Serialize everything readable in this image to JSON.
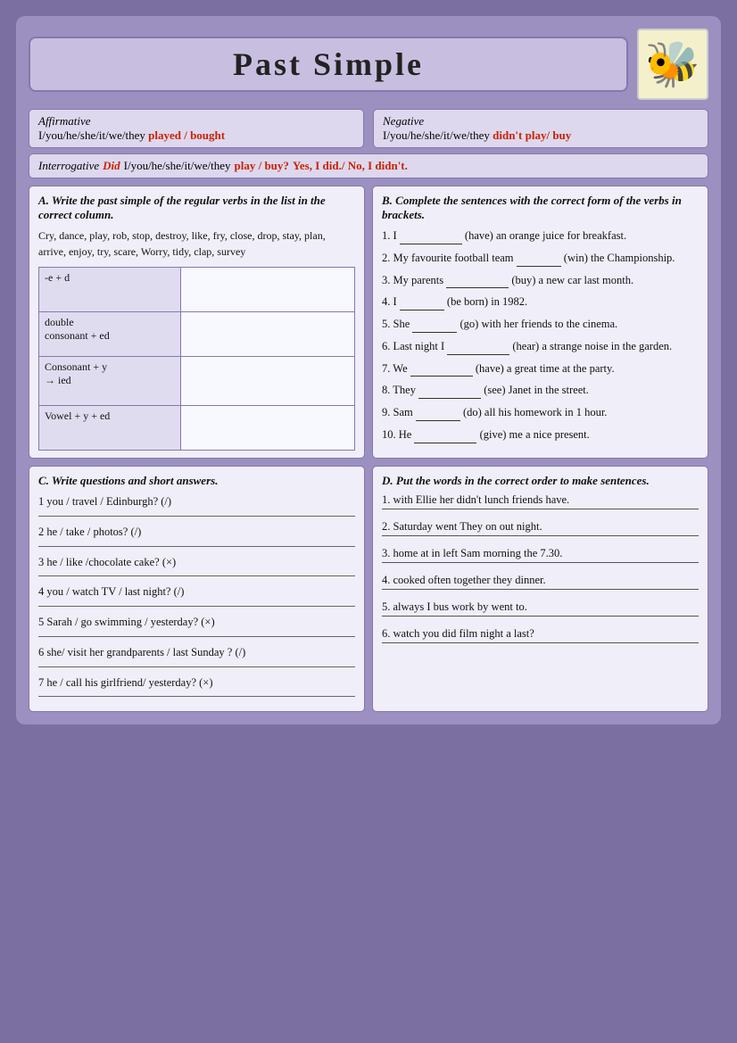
{
  "page": {
    "title": "Past Simple",
    "bee_icon": "🐝",
    "grammar": {
      "affirmative_label": "Affirmative",
      "affirmative_subject": "I/you/he/she/it/we/they",
      "affirmative_verbs": "played / bought",
      "negative_label": "Negative",
      "negative_subject": "I/you/he/she/it/we/they",
      "negative_verbs": "didn't play/ buy",
      "interrogative_label": "Interrogative",
      "interrogative_did": "Did",
      "interrogative_subject": "I/you/he/she/it/we/they",
      "interrogative_verbs": "play / buy?",
      "interrogative_answer": "Yes, I did./ No, I didn't."
    },
    "section_a": {
      "title": "A. Write the past simple of the regular verbs in the list in the correct column.",
      "verb_list": "Cry, dance, play, rob, stop, destroy, like, fry, close, drop, stay, plan, arrive, enjoy, try, scare, Worry, tidy, clap, survey",
      "rows": [
        {
          "label": "-e + d",
          "content": ""
        },
        {
          "label": "double consonant + ed",
          "content": ""
        },
        {
          "label": "Consonant + y → ied",
          "content": ""
        },
        {
          "label": "Vowel + y + ed",
          "content": ""
        }
      ]
    },
    "section_b": {
      "title": "B. Complete the sentences with the correct form of the verbs in brackets.",
      "sentences": [
        {
          "num": "1.",
          "before": "I",
          "blank": "",
          "after": "(have) an orange juice for breakfast."
        },
        {
          "num": "2.",
          "before": "My favourite football team",
          "blank": "",
          "after": "(win) the Championship."
        },
        {
          "num": "3.",
          "before": "My parents",
          "blank": "",
          "after": "(buy) a new car last month."
        },
        {
          "num": "4.",
          "before": "I",
          "blank": "",
          "after": "(be born) in 1982."
        },
        {
          "num": "5.",
          "before": "She",
          "blank": "",
          "after": "(go) with her friends to the cinema."
        },
        {
          "num": "6.",
          "before": "Last night I",
          "blank": "",
          "after": "(hear) a strange noise in the garden."
        },
        {
          "num": "7.",
          "before": "We",
          "blank": "",
          "after": "(have) a great time at the party."
        },
        {
          "num": "8.",
          "before": "They",
          "blank": "",
          "after": "(see) Janet in the street."
        },
        {
          "num": "9.",
          "before": "Sam",
          "blank": "",
          "after": "(do) all his homework in 1 hour."
        },
        {
          "num": "10.",
          "before": "He",
          "blank": "",
          "after": "(give) me a nice present."
        }
      ]
    },
    "section_c": {
      "title": "C. Write questions and short answers.",
      "items": [
        "1 you / travel / Edinburgh? (/)",
        "2 he / take / photos? (/)",
        "3 he / like /chocolate cake? (×)",
        "4 you / watch TV / last night? (/)",
        "5 Sarah / go swimming / yesterday? (×)",
        "6 she/ visit her grandparents / last Sunday ? (/)",
        "7 he / call his girlfriend/ yesterday? (×)"
      ]
    },
    "section_d": {
      "title": "D. Put the words in the correct order to make sentences.",
      "sentences": [
        "1. with Ellie her didn't lunch friends have.",
        "2. Saturday went They on out night.",
        "3. home at in left Sam morning the 7.30.",
        "4. cooked often together they dinner.",
        "5. always I bus work by went to.",
        "6. watch you did film night a last?"
      ]
    }
  }
}
